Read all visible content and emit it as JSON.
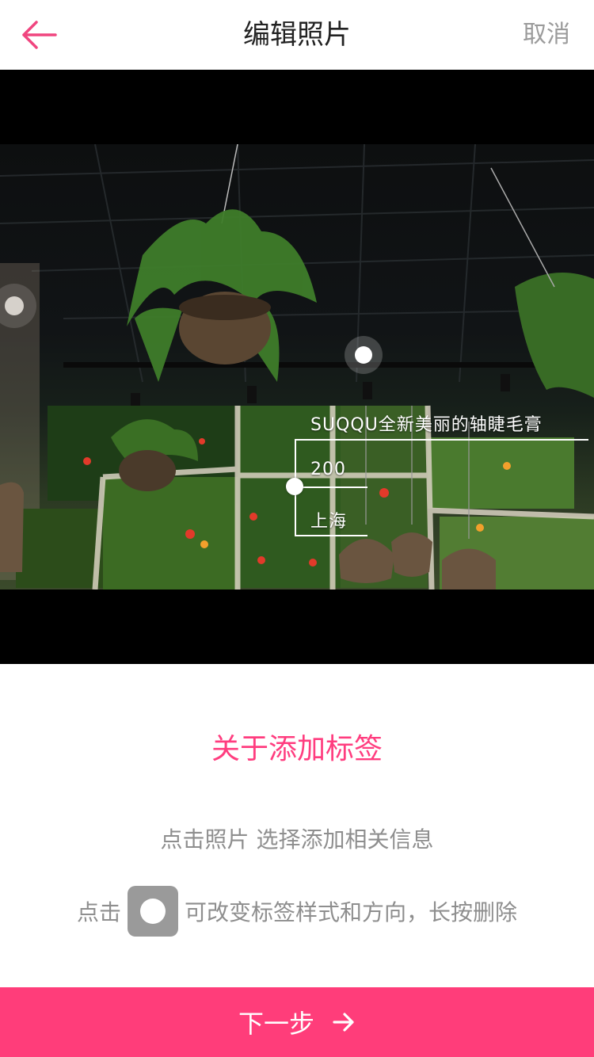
{
  "header": {
    "title": "编辑照片",
    "cancel_label": "取消",
    "back_icon": "arrow-left-icon"
  },
  "photo": {
    "tag": {
      "title": "SUQQU全新美丽的轴睫毛膏",
      "price": "200",
      "location": "上海"
    }
  },
  "help": {
    "title": "关于添加标签",
    "line1": "点击照片 选择添加相关信息",
    "line2_prefix": "点击",
    "line2_suffix": "可改变标签样式和方向，长按删除",
    "style_icon": "tag-style-toggle-icon"
  },
  "footer": {
    "next_label": "下一步",
    "next_icon": "arrow-right-icon"
  },
  "colors": {
    "accent": "#ff3d7a",
    "back_arrow": "#f0457f",
    "muted_text": "#8e8e8e"
  }
}
